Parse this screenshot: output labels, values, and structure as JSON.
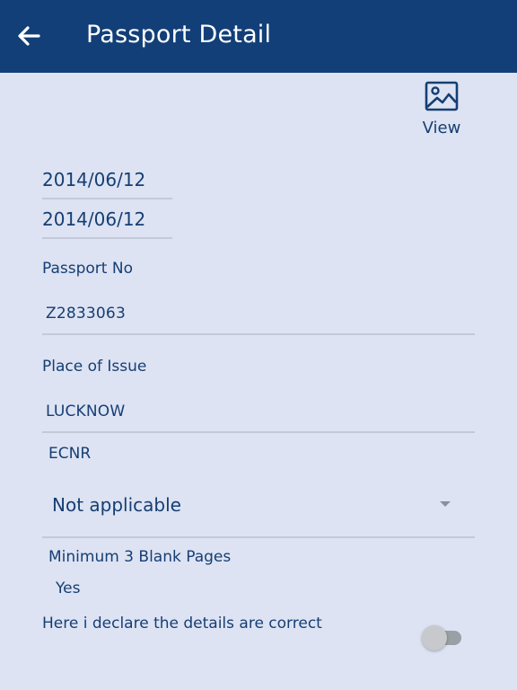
{
  "header": {
    "title": "Passport Detail",
    "back_icon": "arrow-left-icon",
    "background_color": "#123f78"
  },
  "view": {
    "label": "View",
    "icon": "image-icon"
  },
  "dates": {
    "issue_date": "2014/06/12",
    "expiry_date": "2014/06/12"
  },
  "passport_no": {
    "label": "Passport No",
    "value": "Z2833063"
  },
  "place_of_issue": {
    "label": "Place of Issue",
    "value": "LUCKNOW"
  },
  "ecnr": {
    "label": "ECNR",
    "selected": "Not applicable"
  },
  "blank_pages": {
    "label": "Minimum 3 Blank Pages",
    "value": "Yes"
  },
  "declaration": {
    "text": "Here i declare the details are correct",
    "toggle_on": false
  },
  "colors": {
    "page_background": "#dde3f3",
    "text": "#163e73"
  }
}
